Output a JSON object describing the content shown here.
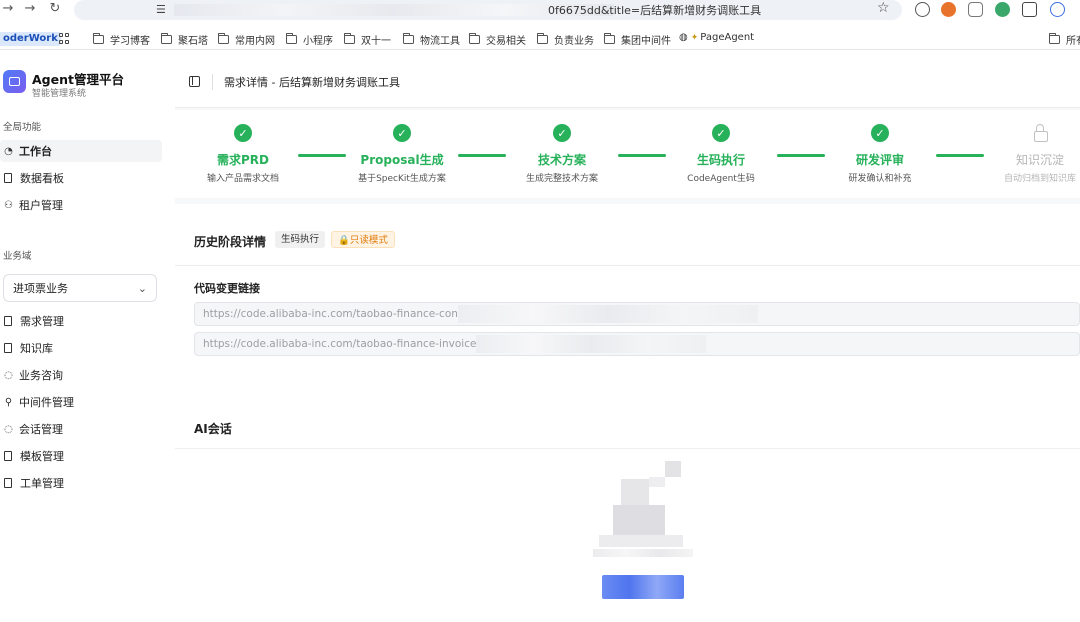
{
  "browser": {
    "url_visible_text": "0f6675dd&title=后结算新增财务调账工具",
    "coder_badge": "oderWork",
    "bookmarks": [
      "学习博客",
      "聚石塔",
      "常用内网",
      "小程序",
      "双十一",
      "物流工具",
      "交易相关",
      "负责业务",
      "集团中间件",
      "PageAgent",
      "所有"
    ]
  },
  "sidebar": {
    "app_title": "Agent管理平台",
    "app_subtitle": "智能管理系统",
    "global_section_label": "全局功能",
    "global_items": [
      {
        "label": "工作台",
        "icon": "dashboard-icon",
        "active": true
      },
      {
        "label": "数据看板",
        "icon": "document-icon",
        "active": false
      },
      {
        "label": "租户管理",
        "icon": "users-icon",
        "active": false
      }
    ],
    "business_section_label": "业务域",
    "business_select": "进项票业务",
    "business_items": [
      {
        "label": "需求管理",
        "icon": "document-icon"
      },
      {
        "label": "知识库",
        "icon": "book-icon"
      },
      {
        "label": "业务咨询",
        "icon": "chat-icon"
      },
      {
        "label": "中间件管理",
        "icon": "plug-icon"
      },
      {
        "label": "会话管理",
        "icon": "chat-icon"
      },
      {
        "label": "模板管理",
        "icon": "document-icon"
      },
      {
        "label": "工单管理",
        "icon": "document-icon"
      }
    ]
  },
  "header": {
    "title": "需求详情 - 后结算新增财务调账工具"
  },
  "steps": [
    {
      "title": "需求PRD",
      "desc": "输入产品需求文档",
      "status": "done"
    },
    {
      "title": "Proposal生成",
      "desc": "基于SpecKit生成方案",
      "status": "done"
    },
    {
      "title": "技术方案",
      "desc": "生成完整技术方案",
      "status": "done"
    },
    {
      "title": "生码执行",
      "desc": "CodeAgent生码",
      "status": "done"
    },
    {
      "title": "研发评审",
      "desc": "研发确认和补充",
      "status": "done"
    },
    {
      "title": "知识沉淀",
      "desc": "自动归档到知识库",
      "status": "locked"
    }
  ],
  "history": {
    "title": "历史阶段详情",
    "stage_tag": "生码执行",
    "readonly_tag": "🔒只读模式",
    "field_label": "代码变更链接",
    "links": [
      "https://code.alibaba-inc.com/taobao-finance-con",
      "https://code.alibaba-inc.com/taobao-finance-invoice"
    ]
  },
  "ai_chat": {
    "title": "AI会话"
  },
  "colors": {
    "accent_green": "#27b15a",
    "locked_gray": "#b6b6b6",
    "readonly_orange": "#e07d10"
  }
}
